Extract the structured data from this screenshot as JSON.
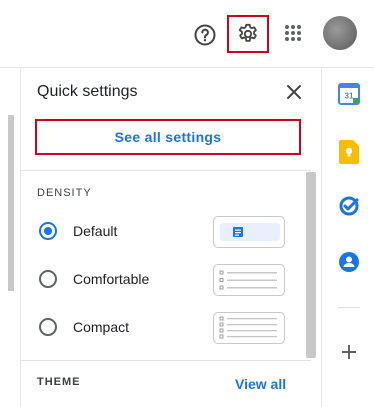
{
  "header": {
    "help_icon": "help-circle-icon",
    "settings_icon": "gear-icon",
    "apps_icon": "apps-grid-icon",
    "avatar": "account-avatar"
  },
  "quick_settings": {
    "title": "Quick settings",
    "close_icon": "close-icon",
    "see_all_label": "See all settings",
    "density": {
      "label": "DENSITY",
      "options": [
        {
          "label": "Default",
          "selected": true
        },
        {
          "label": "Comfortable",
          "selected": false
        },
        {
          "label": "Compact",
          "selected": false
        }
      ]
    },
    "theme": {
      "label": "THEME",
      "view_all_label": "View all"
    }
  },
  "side_panel": {
    "calendar_day": "31",
    "apps": [
      "calendar-icon",
      "keep-icon",
      "tasks-icon",
      "contacts-icon",
      "add-icon"
    ]
  },
  "colors": {
    "accent": "#1a73e8",
    "highlight_border": "#d0021b",
    "calendar_blue": "#4285f4",
    "keep_yellow": "#fbbc04",
    "tasks_blue": "#1a73e8",
    "contacts_blue": "#1a73e8"
  }
}
